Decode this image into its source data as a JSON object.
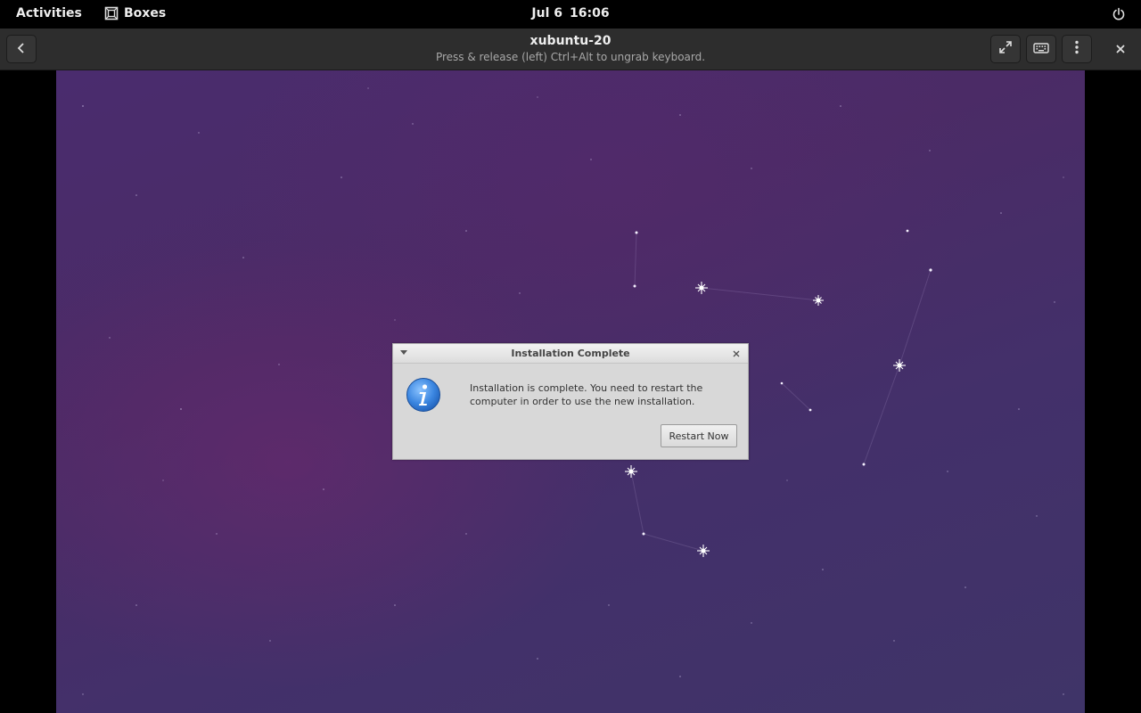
{
  "topbar": {
    "activities_label": "Activities",
    "app_name": "Boxes",
    "date": "Jul 6",
    "time": "16:06",
    "icons": {
      "app": "boxes-icon",
      "power": "power-icon"
    }
  },
  "headerbar": {
    "title": "xubuntu-20",
    "subtitle": "Press & release (left) Ctrl+Alt to ungrab keyboard.",
    "icons": {
      "back": "chevron-left-icon",
      "fullscreen": "fullscreen-icon",
      "keyboard": "keyboard-icon",
      "menu": "vertical-dots-icon",
      "close": "close-icon"
    }
  },
  "guest_dialog": {
    "title": "Installation Complete",
    "message": "Installation is complete. You need to restart the computer in order to use the new installation.",
    "button_label": "Restart Now",
    "icons": {
      "info": "info-icon",
      "close": "close-icon",
      "window_menu": "chevron-down-icon"
    }
  },
  "colors": {
    "shell_bg": "#000000",
    "headerbar_bg": "#2d2d2d",
    "wallpaper": "#47306a",
    "dialog_bg": "#d8d8d8"
  }
}
